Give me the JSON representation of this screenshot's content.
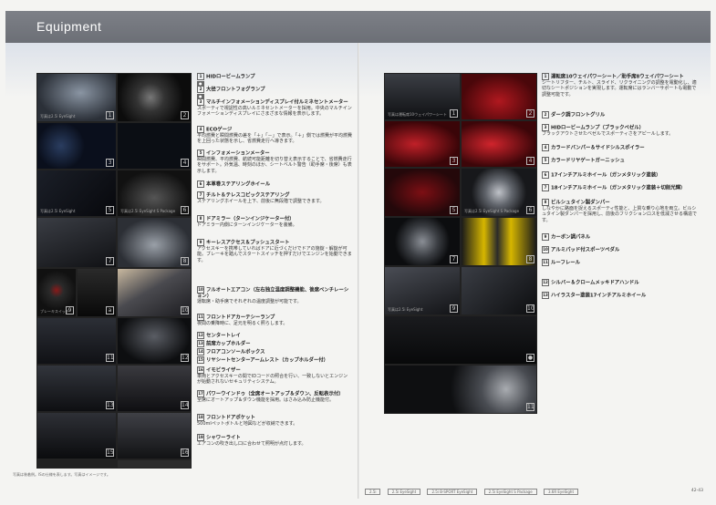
{
  "header": {
    "title": "Equipment"
  },
  "left_photos": [
    {
      "num": "1",
      "cap": "写真は2.5i EyeSight"
    },
    {
      "num": "2",
      "cap": ""
    },
    {
      "num": "3",
      "cap": ""
    },
    {
      "num": "4",
      "cap": ""
    },
    {
      "num": "5",
      "cap": "写真は2.5i EyeSight"
    },
    {
      "num": "6",
      "cap": "写真は2.5i EyeSight S Package"
    },
    {
      "num": "7",
      "cap": ""
    },
    {
      "num": "8",
      "cap": ""
    },
    {
      "num": "9",
      "cap": "ブレーキスイッチ"
    },
    {
      "num": "10",
      "cap": ""
    },
    {
      "num": "11",
      "cap": ""
    },
    {
      "num": "12",
      "cap": ""
    },
    {
      "num": "13",
      "cap": ""
    },
    {
      "num": "14",
      "cap": ""
    },
    {
      "num": "15",
      "cap": ""
    },
    {
      "num": "16",
      "cap": ""
    },
    {
      "num": "17",
      "cap": ""
    },
    {
      "num": "18",
      "cap": ""
    }
  ],
  "left_items": [
    {
      "n": "1",
      "t": "HIDロービームランプ",
      "d": ""
    },
    {
      "n": "2",
      "t": "大径フロントフォグランプ",
      "d": ""
    },
    {
      "n": "3",
      "t": "マルチインフォメーションディスプレイ付ルミネセントメーター",
      "d": "スポーティで視認性の高いルミネセントメーターを採用。中央のマルチインフォメーションディスプレイにさまざまな情報を表示します。"
    },
    {
      "n": "4",
      "t": "ECOゲージ",
      "d": "平均燃費と瞬間燃費の差を「＋」「－」で表示。「＋」側では燃費が平均燃費を上回った状態を示し、省燃費走行へ導きます。"
    },
    {
      "n": "5",
      "t": "インフォメーションメーター",
      "d": "瞬間燃費、平均燃費、航続可能距離を切り替え表示することで、省燃費走行をサポート。外気温、時刻のほか、シートベルト警告（助手席・後席）も表示します。"
    },
    {
      "n": "6",
      "t": "本革巻ステアリングホイール",
      "d": ""
    },
    {
      "n": "7",
      "t": "チルト＆テレスコピックステアリング",
      "d": "ステアリングホイールを上下、前後に無段階で調整できます。"
    },
    {
      "n": "8",
      "t": "ドアミラー（ターンインジケーター付）",
      "d": "ドアミラー内側にターンインジケーターを装備。"
    },
    {
      "n": "9",
      "t": "キーレスアクセス＆プッシュスタート",
      "d": "アクセスキーを携帯していればドアに近づくだけでドアの施錠・解錠が可能。ブレーキを踏んでスタートスイッチを押すだけでエンジンを始動できます。"
    },
    {
      "n": "10",
      "t": "フルオートエアコン（左右独立温度調整機能、後席ベンチレーション）",
      "d": "運転席・助手席でそれぞれの温度調整が可能です。"
    },
    {
      "n": "11",
      "t": "フロントドアカーテシーランプ",
      "d": "夜間の乗降時に、足元を明るく照らします。"
    },
    {
      "n": "12",
      "t": "センタートレイ",
      "d": ""
    },
    {
      "n": "13",
      "t": "前席カップホルダー",
      "d": ""
    },
    {
      "n": "14",
      "t": "フロアコンソールボックス",
      "d": ""
    },
    {
      "n": "15",
      "t": "リヤシートセンターアームレスト（カップホルダー付）",
      "d": ""
    },
    {
      "n": "16",
      "t": "イモビライザー",
      "d": "車両とアクセスキーの間でIDコードの照合を行い、一致しないとエンジンが始動されないセキュリティシステム。"
    },
    {
      "n": "17",
      "t": "パワーウインドゥ（全席オートアップ＆ダウン、反転表示付）",
      "d": "全席にオートアップ＆ダウン機能を採用。はさみ込み防止機能付。"
    },
    {
      "n": "18",
      "t": "フロントドアポケット",
      "d": "500mlペットボトルと地図などが収納できます。"
    },
    {
      "n": "19",
      "t": "シャワーライト",
      "d": "エアコンの吹き出し口に合わせて照明が点灯します。"
    }
  ],
  "right_photos": [
    {
      "num": "1",
      "cap": "写真は運転席10ウェイパワーシート"
    },
    {
      "num": "2",
      "cap": ""
    },
    {
      "num": "3",
      "cap": ""
    },
    {
      "num": "4",
      "cap": ""
    },
    {
      "num": "5",
      "cap": ""
    },
    {
      "num": "6",
      "cap": "写真は2.5i EyeSight S Package"
    },
    {
      "num": "7",
      "cap": ""
    },
    {
      "num": "8",
      "cap": ""
    },
    {
      "num": "9",
      "cap": "写真は2.5i EyeSight"
    },
    {
      "num": "10",
      "cap": ""
    },
    {
      "num": "11",
      "cap": ""
    }
  ],
  "right_items": [
    {
      "n": "1",
      "t": "運転席10ウェイパワーシート／助手席8ウェイパワーシート",
      "d": "シートリフター、チルト、スライド、リクライニングの調整を電動化し、適切なシートポジションを実現します。運転席にはランバーサポートも電動で調整可能です。"
    },
    {
      "n": "2",
      "t": "ダーク調フロントグリル",
      "d": ""
    },
    {
      "n": "3",
      "t": "HIDロービームランプ（ブラックベゼル）",
      "d": "ブラックアウトさせたベゼルでスポーティさをアピールします。"
    },
    {
      "n": "4",
      "t": "カラードバンパー＆サイドシルスポイラー",
      "d": ""
    },
    {
      "n": "5",
      "t": "カラードリヤゲートガーニッシュ",
      "d": ""
    },
    {
      "n": "6",
      "t": "17インチアルミホイール（ガンメタリック塗装）",
      "d": ""
    },
    {
      "n": "7",
      "t": "18インチアルミホイール（ガンメタリック塗装＋切削光輝）",
      "d": ""
    },
    {
      "n": "8",
      "t": "ビルシュタイン製ダンパー",
      "d": "しなやかに路面を捉えるスポーティ性能と、上質な乗り心地を両立。ビルシュタイン製ダンパーを採用し、前後のフリクションロスを低減させる構造です。"
    },
    {
      "n": "9",
      "t": "カーボン調パネル",
      "d": ""
    },
    {
      "n": "10",
      "t": "アルミパッド付スポーツペダル",
      "d": ""
    },
    {
      "n": "11",
      "t": "ルーフレール",
      "d": ""
    },
    {
      "n": "12",
      "t": "シルバー＆クロームメッキドアハンドル",
      "d": ""
    },
    {
      "n": "13",
      "t": "ハイラスター塗装17インチアルミホイール",
      "d": ""
    }
  ],
  "footer": {
    "left_note": "写真は装着例。ISの仕様を表します。写真はイメージです。",
    "grades": [
      "2.5i",
      "2.5i EyeSight",
      "2.5i B-SPORT EyeSight",
      "2.5i EyeSight S Package",
      "3.6R EyeSight"
    ],
    "page": "42-43"
  }
}
